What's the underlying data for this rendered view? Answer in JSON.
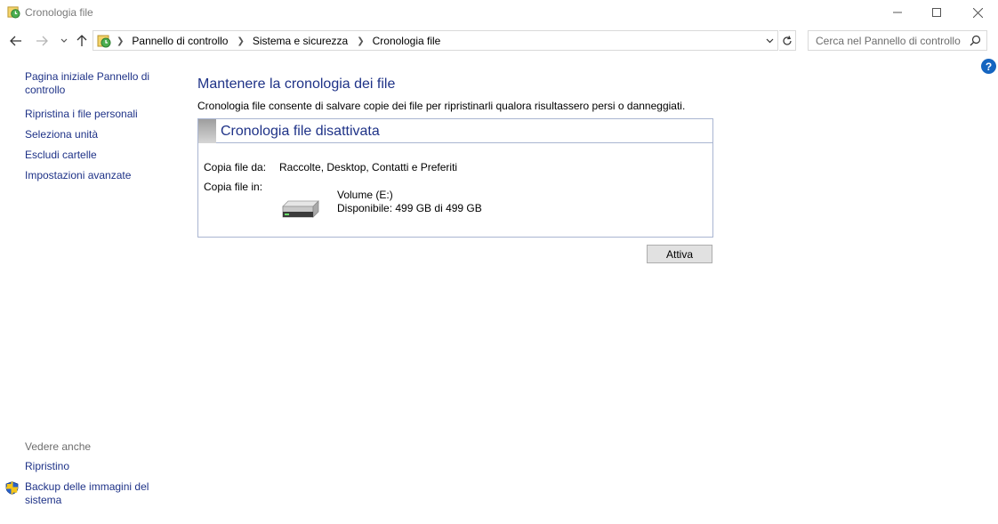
{
  "window": {
    "title": "Cronologia file",
    "icon": "file-history-icon"
  },
  "address_bar": {
    "breadcrumbs": [
      "Pannello di controllo",
      "Sistema e sicurezza",
      "Cronologia file"
    ]
  },
  "search": {
    "placeholder": "Cerca nel Pannello di controllo"
  },
  "help": {
    "label": "?"
  },
  "left_pane": {
    "home": "Pagina iniziale Pannello di controllo",
    "items": [
      {
        "label": "Ripristina i file personali"
      },
      {
        "label": "Seleziona unità"
      },
      {
        "label": "Escludi cartelle"
      },
      {
        "label": "Impostazioni avanzate"
      }
    ],
    "see_also": {
      "title": "Vedere anche",
      "items": [
        {
          "label": "Ripristino"
        },
        {
          "label": "Backup delle immagini del sistema"
        }
      ]
    }
  },
  "main": {
    "title": "Mantenere la cronologia dei file",
    "description": "Cronologia file consente di salvare copie dei file per ripristinarli qualora risultassero persi o danneggiati.",
    "status": {
      "title": "Cronologia file disattivata",
      "copy_from_label": "Copia file da:",
      "copy_from_value": "Raccolte, Desktop, Contatti e Preferiti",
      "copy_to_label": "Copia file in:",
      "drive_name": "Volume (E:)",
      "drive_free": "Disponibile: 499 GB di 499 GB"
    },
    "activate_button": "Attiva"
  },
  "colors": {
    "link": "#1e3287",
    "panel_border": "#a9b5d1",
    "help_icon": "#1565c0"
  }
}
